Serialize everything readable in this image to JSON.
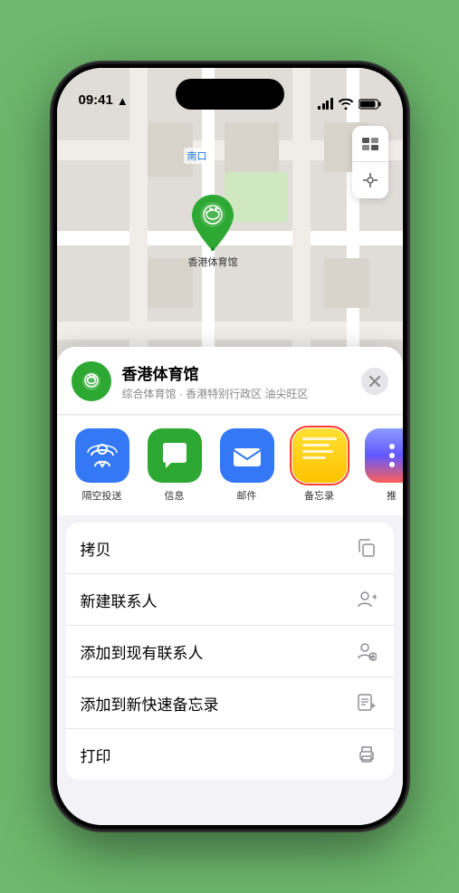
{
  "status_bar": {
    "time": "09:41",
    "location_arrow": "▲"
  },
  "map": {
    "label": "南口",
    "pin_location": "香港体育馆"
  },
  "location_card": {
    "name": "香港体育馆",
    "subtitle": "综合体育馆 · 香港特别行政区 油尖旺区",
    "close_label": "×"
  },
  "share_items": [
    {
      "id": "airdrop",
      "label": "隔空投送",
      "selected": false
    },
    {
      "id": "messages",
      "label": "信息",
      "selected": false
    },
    {
      "id": "mail",
      "label": "邮件",
      "selected": false
    },
    {
      "id": "notes",
      "label": "备忘录",
      "selected": true
    },
    {
      "id": "more",
      "label": "推",
      "selected": false
    }
  ],
  "action_items": [
    {
      "id": "copy",
      "label": "拷贝",
      "icon": "copy"
    },
    {
      "id": "new-contact",
      "label": "新建联系人",
      "icon": "person-plus"
    },
    {
      "id": "add-contact",
      "label": "添加到现有联系人",
      "icon": "person-add"
    },
    {
      "id": "quick-note",
      "label": "添加到新快速备忘录",
      "icon": "note"
    },
    {
      "id": "print",
      "label": "打印",
      "icon": "printer"
    }
  ],
  "colors": {
    "green": "#2da832",
    "blue": "#3478f6",
    "red": "#ff3b30",
    "bg": "#f2f2f7"
  }
}
